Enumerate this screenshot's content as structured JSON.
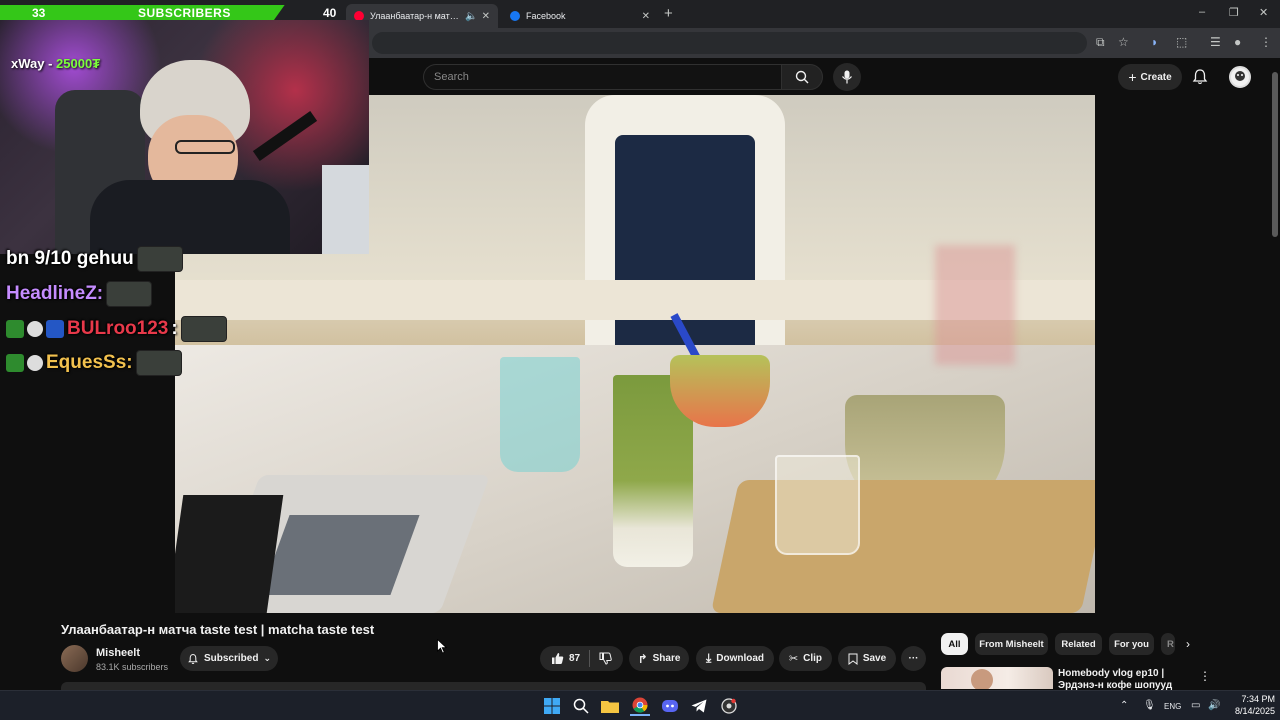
{
  "browser": {
    "tabs": [
      {
        "title": "Улаанбаатар-н матча taste test | matcha taste test",
        "active": true
      },
      {
        "title": "Facebook",
        "active": false
      }
    ],
    "new_tab": "+",
    "window_controls": {
      "minimize": "–",
      "restore": "❐",
      "close": "✕"
    }
  },
  "youtube": {
    "search": {
      "placeholder": "Search"
    },
    "create_label": "Create",
    "video": {
      "title": "Улаанбаатар-н матча taste test | matcha taste test",
      "channel": "Misheelt",
      "subscribers": "83.1K subscribers",
      "subscribed_label": "Subscribed",
      "likes": "87",
      "share_label": "Share",
      "download_label": "Download",
      "clip_label": "Clip",
      "save_label": "Save",
      "more_label": "···"
    },
    "chips": [
      "All",
      "From Misheelt",
      "Related",
      "For you",
      "R"
    ],
    "recommendation": {
      "title": "Homebody vlog ep10 | Эрдэнэ-н кофе шопууд"
    }
  },
  "stream_overlay": {
    "sub_goal": {
      "current": "33",
      "label": "SUBSCRIBERS",
      "target": "40",
      "progress": 0.825
    },
    "donation": {
      "name": "xWay -",
      "amount": "25000₮"
    },
    "chat": [
      {
        "user": "bn 9/10 gehuu",
        "color": "#ffffff",
        "badges": []
      },
      {
        "user": "HeadlineZ:",
        "color": "#c58cff",
        "badges": []
      },
      {
        "user": "BULroo123",
        "color": "#e8394a",
        "badges": [
          "1st",
          "cat",
          "flag"
        ]
      },
      {
        "user": "EquesSs:",
        "color": "#f2c14e",
        "badges": [
          "1st",
          "cat"
        ]
      }
    ]
  },
  "taskbar": {
    "language": "ENG",
    "time": "7:34 PM",
    "date": "8/14/2025"
  },
  "colors": {
    "accent_green": "#34c718",
    "yt_bg": "#0f0f0f",
    "chip_bg": "#272727"
  }
}
